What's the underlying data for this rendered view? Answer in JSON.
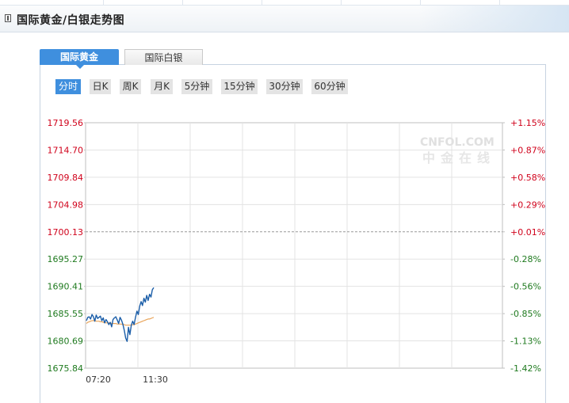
{
  "header": {
    "title": "国际黄金/白银走势图"
  },
  "tabs": [
    {
      "label": "国际黄金",
      "active": true
    },
    {
      "label": "国际白银",
      "active": false
    }
  ],
  "periods": [
    {
      "label": "分时",
      "active": true
    },
    {
      "label": "日K"
    },
    {
      "label": "周K"
    },
    {
      "label": "月K"
    },
    {
      "label": "5分钟"
    },
    {
      "label": "15分钟"
    },
    {
      "label": "30分钟"
    },
    {
      "label": "60分钟"
    }
  ],
  "watermark": {
    "logo": "CNFOL.COM",
    "sub": "中金在线"
  },
  "colors": {
    "accent": "#3f8fde",
    "up": "#d0021b",
    "down": "#1f7a1f",
    "price_line": "#1a5da8",
    "avg_line": "#e9a55b"
  },
  "chart_data": {
    "type": "line",
    "reference": 1700.13,
    "ylim": [
      1675.84,
      1719.56
    ],
    "y_ticks": [
      "1719.56",
      "1714.70",
      "1709.84",
      "1704.98",
      "1700.13",
      "1695.27",
      "1690.41",
      "1685.55",
      "1680.69",
      "1675.84"
    ],
    "pct_ticks": [
      "+1.15%",
      "+0.87%",
      "+0.58%",
      "+0.29%",
      "+0.01%",
      "-0.28%",
      "-0.56%",
      "-0.85%",
      "-1.13%",
      "-1.42%"
    ],
    "x_ticks": [
      "07:20",
      "11:30"
    ],
    "series": [
      {
        "key": "price",
        "values": [
          1684.3,
          1684.9,
          1685.0,
          1684.6,
          1685.4,
          1685.0,
          1684.2,
          1685.3,
          1684.7,
          1684.9,
          1685.1,
          1684.3,
          1684.8,
          1683.9,
          1684.5,
          1684.1,
          1683.6,
          1684.0,
          1683.2,
          1684.5,
          1684.8,
          1685.0,
          1684.4,
          1683.8,
          1684.9,
          1684.4,
          1683.7,
          1682.6,
          1681.2,
          1680.6,
          1683.1,
          1681.8,
          1683.5,
          1684.2,
          1683.6,
          1684.9,
          1686.0,
          1685.4,
          1686.9,
          1687.7,
          1687.0,
          1688.3,
          1687.6,
          1688.8,
          1687.9,
          1689.0,
          1688.5,
          1689.8,
          1690.2
        ]
      },
      {
        "key": "average",
        "values": [
          1683.8,
          1684.0,
          1684.1,
          1684.2,
          1684.3,
          1684.3,
          1684.3,
          1684.2,
          1684.2,
          1684.2,
          1684.1,
          1684.1,
          1684.0,
          1684.0,
          1683.9,
          1683.9,
          1683.9,
          1683.9,
          1683.8,
          1683.8,
          1683.8,
          1683.8,
          1683.7,
          1683.7,
          1683.7,
          1683.7,
          1683.6,
          1683.6,
          1683.5,
          1683.5,
          1683.5,
          1683.5,
          1683.5,
          1683.6,
          1683.6,
          1683.7,
          1683.8,
          1683.9,
          1684.0,
          1684.1,
          1684.2,
          1684.3,
          1684.4,
          1684.5,
          1684.6,
          1684.6,
          1684.7,
          1684.8,
          1684.9
        ]
      }
    ]
  }
}
